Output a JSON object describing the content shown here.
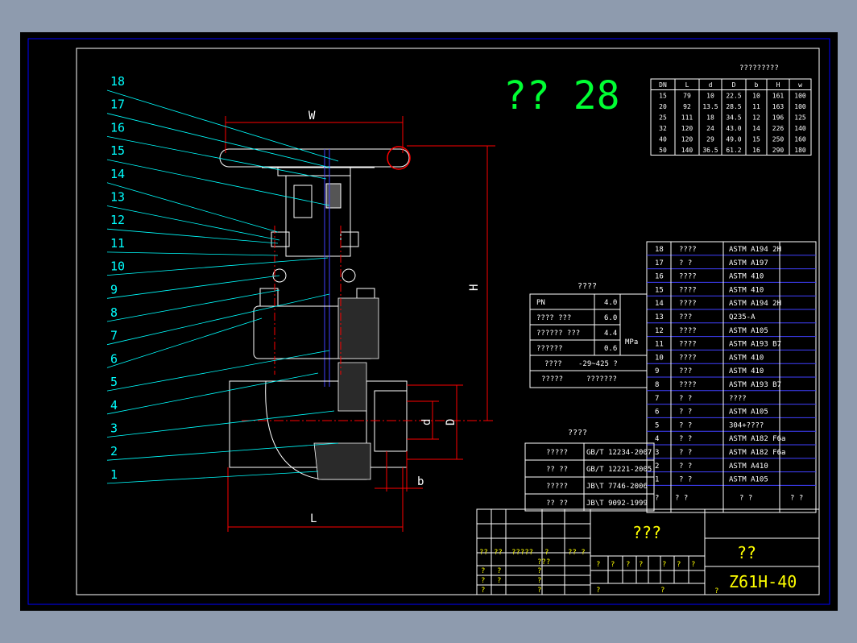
{
  "title_big": "?? 28",
  "dim_table": {
    "caption": "?????????",
    "headers": [
      "DN",
      "L",
      "d",
      "D",
      "b",
      "H",
      "w"
    ],
    "rows": [
      [
        "15",
        "79",
        "10",
        "22.5",
        "10",
        "161",
        "100"
      ],
      [
        "20",
        "92",
        "13.5",
        "28.5",
        "11",
        "163",
        "100"
      ],
      [
        "25",
        "111",
        "18",
        "34.5",
        "12",
        "196",
        "125"
      ],
      [
        "32",
        "120",
        "24",
        "43.0",
        "14",
        "226",
        "140"
      ],
      [
        "40",
        "120",
        "29",
        "49.0",
        "15",
        "250",
        "160"
      ],
      [
        "50",
        "140",
        "36.5",
        "61.2",
        "16",
        "290",
        "180"
      ]
    ]
  },
  "parts_table": {
    "rows": [
      [
        "18",
        "????",
        "ASTM A194 2H"
      ],
      [
        "17",
        "?  ?",
        "ASTM A197"
      ],
      [
        "16",
        "????",
        "ASTM 410"
      ],
      [
        "15",
        "????",
        "ASTM 410"
      ],
      [
        "14",
        "????",
        "ASTM A194 2H"
      ],
      [
        "13",
        "???",
        "Q235-A"
      ],
      [
        "12",
        "????",
        "ASTM A105"
      ],
      [
        "11",
        "????",
        "ASTM A193 B7"
      ],
      [
        "10",
        "????",
        "ASTM 410"
      ],
      [
        "9",
        "???",
        "ASTM 410"
      ],
      [
        "8",
        "????",
        "ASTM A193 B7"
      ],
      [
        "7",
        "?  ?",
        "????"
      ],
      [
        "6",
        "?  ?",
        "ASTM A105"
      ],
      [
        "5",
        "?  ?",
        "304+????"
      ],
      [
        "4",
        "?  ?",
        "ASTM A182 F6a"
      ],
      [
        "3",
        "?  ?",
        "ASTM A182 F6a"
      ],
      [
        "2",
        "?  ?",
        "ASTM A410"
      ],
      [
        "1",
        "?  ?",
        "ASTM A105"
      ]
    ],
    "footer": [
      "?",
      "?   ?",
      "?   ?",
      "? ?"
    ]
  },
  "perf_table": {
    "caption": "????",
    "rows": [
      [
        "PN",
        "4.0"
      ],
      [
        "???? ???",
        "6.0"
      ],
      [
        "?????? ???",
        "4.4"
      ],
      [
        "??????",
        "0.6"
      ]
    ],
    "unit": "MPa",
    "temp_label": "????",
    "temp_value": "-29~425 ?",
    "medium_label": "?????",
    "medium_value": "???????"
  },
  "std_table": {
    "caption": "????",
    "rows": [
      [
        "?????",
        "GB/T 12234-2007"
      ],
      [
        "??  ??",
        "GB/T 12221-2005"
      ],
      [
        "?????",
        "JB\\T 7746-2006"
      ],
      [
        "??  ??",
        "JB\\T 9092-1999"
      ]
    ]
  },
  "title_block": {
    "drawing_title": "???",
    "name": "??",
    "model": "Z61H-40",
    "small_cells": [
      "??",
      "??",
      "?????",
      "?",
      "?? ?",
      "???",
      "?",
      "?",
      "?",
      "?",
      "?",
      "?",
      "?",
      "?",
      "?",
      "?",
      "?",
      "?",
      "?",
      "?",
      "?",
      "?",
      "?",
      "?",
      "?",
      "?"
    ]
  },
  "balloons": [
    "18",
    "17",
    "16",
    "15",
    "14",
    "13",
    "12",
    "11",
    "10",
    "9",
    "8",
    "7",
    "6",
    "5",
    "4",
    "3",
    "2",
    "1"
  ],
  "dim_labels": {
    "w": "W",
    "h": "H",
    "l": "L",
    "d": "d",
    "D": "D",
    "b": "b"
  }
}
